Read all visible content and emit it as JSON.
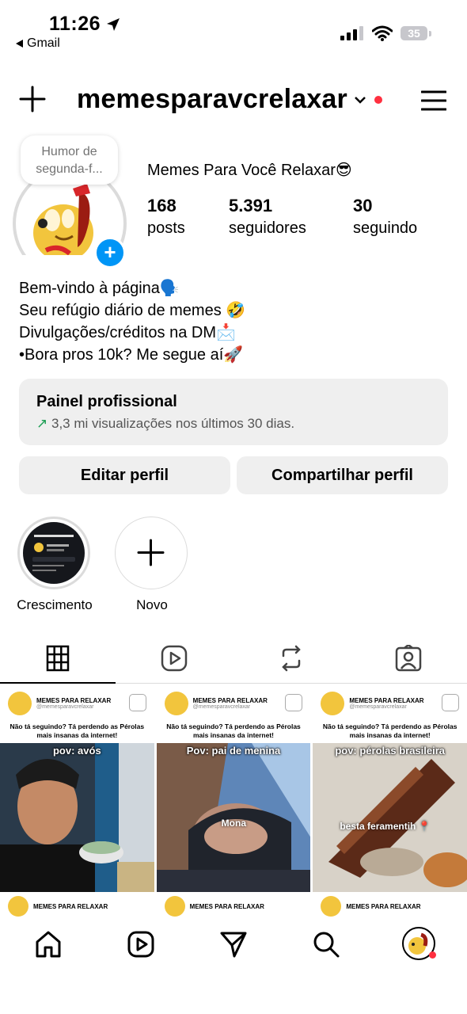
{
  "status": {
    "time": "11:26",
    "back_app": "Gmail",
    "battery": "35"
  },
  "header": {
    "username": "memesparavcrelaxar"
  },
  "profile": {
    "note": "Humor de segunda-f...",
    "display_name": "Memes Para Você Relaxar😎",
    "stats": [
      {
        "value": "168",
        "label": "posts"
      },
      {
        "value": "5.391",
        "label": "seguidores"
      },
      {
        "value": "30",
        "label": "seguindo"
      }
    ],
    "bio": [
      "Bem-vindo à página🗣️",
      "Seu refúgio diário de memes 🤣",
      "Divulgações/créditos na DM📩",
      "•Bora pros 10k? Me segue aí🚀"
    ]
  },
  "panel": {
    "title": "Painel profissional",
    "subtitle": "3,3 mi visualizações nos últimos 30 dias."
  },
  "buttons": {
    "edit": "Editar perfil",
    "share": "Compartilhar perfil"
  },
  "highlights": [
    {
      "label": "Crescimento"
    },
    {
      "label": "Novo"
    }
  ],
  "tabs": [
    {
      "icon": "grid-icon",
      "active": true
    },
    {
      "icon": "reels-icon"
    },
    {
      "icon": "reposts-icon"
    },
    {
      "icon": "tagged-icon"
    }
  ],
  "posts": [
    {
      "brand": "MEMES PARA RELAXAR",
      "handle": "@memesparavcrelaxar",
      "caption": "Não tá seguindo? Tá perdendo as Pérolas mais insanas da internet!",
      "pov": "pov: avós",
      "overlay": ""
    },
    {
      "brand": "MEMES PARA RELAXAR",
      "handle": "@memesparavcrelaxar",
      "caption": "Não tá seguindo? Tá perdendo as Pérolas mais insanas da internet!",
      "pov": "Pov: pai de menina",
      "overlay": "Mona"
    },
    {
      "brand": "MEMES PARA RELAXAR",
      "handle": "@memesparavcrelaxar",
      "caption": "Não tá seguindo? Tá perdendo as Pérolas mais insanas da internet!",
      "pov": "pov: pérolas brasileira",
      "overlay": "besta feramentih 📍"
    }
  ],
  "posts_row2": [
    {
      "brand": "MEMES PARA RELAXAR"
    },
    {
      "brand": "MEMES PARA RELAXAR"
    },
    {
      "brand": "MEMES PARA RELAXAR"
    }
  ],
  "colors": {
    "accent": "#0095f6",
    "notification": "#ff3040",
    "panel_bg": "#efefef"
  }
}
